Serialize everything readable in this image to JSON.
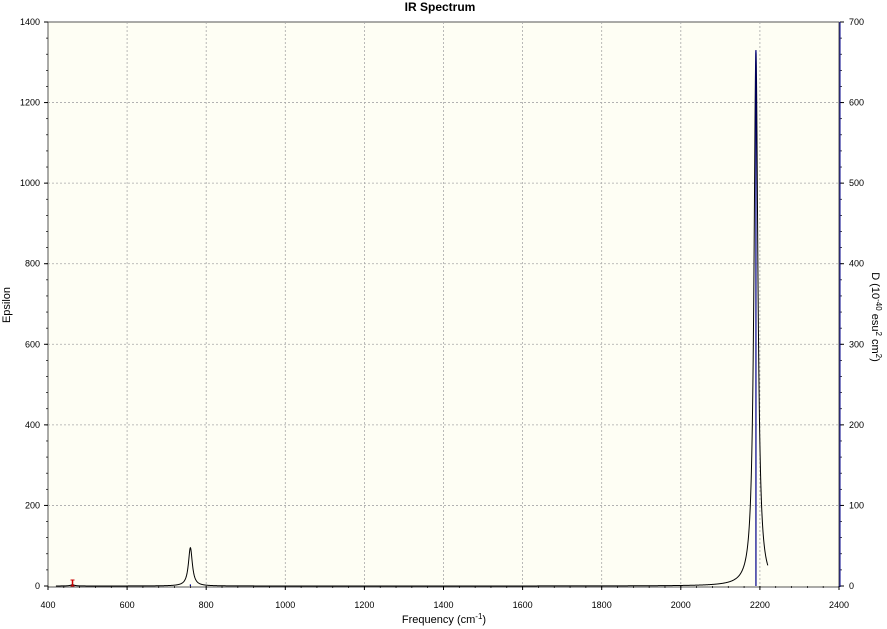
{
  "chart_data": {
    "type": "line",
    "title": "IR Spectrum",
    "xlabel": "Frequency (cm",
    "xlabel_sup": "-1",
    "xlabel_end": ")",
    "ylabel_left": "Epsilon",
    "ylabel_right": {
      "p1": "D (10",
      "s1": "-40",
      "p2": " esu",
      "s2": "2",
      "p3": " cm",
      "s3": "2",
      "p4": ")"
    },
    "xlim": [
      400,
      2400
    ],
    "ylim_left": [
      0,
      1400
    ],
    "ylim_right": [
      0,
      700
    ],
    "xticks": [
      "400",
      "600",
      "800",
      "1000",
      "1200",
      "1400",
      "1600",
      "1800",
      "2000",
      "2200",
      "2400"
    ],
    "yticks_left": [
      "0",
      "200",
      "400",
      "600",
      "800",
      "1000",
      "1200",
      "1400"
    ],
    "yticks_right": [
      "0",
      "100",
      "200",
      "300",
      "400",
      "500",
      "600",
      "700"
    ],
    "grid": true,
    "colors": {
      "background": "#fefef4",
      "spectrum": "#000000",
      "stick": "#00008b",
      "grid": "#a8a8a8",
      "marker": "#cc0000"
    },
    "peaks": [
      {
        "freq": 462,
        "epsilon": 3,
        "width": 12
      },
      {
        "freq": 760,
        "epsilon": 95,
        "width": 12
      },
      {
        "freq": 2190,
        "epsilon": 1330,
        "width": 12
      }
    ],
    "sticks": [
      {
        "freq": 462,
        "strength": 2
      },
      {
        "freq": 760,
        "strength": 2
      },
      {
        "freq": 2190,
        "strength": 665
      }
    ]
  }
}
